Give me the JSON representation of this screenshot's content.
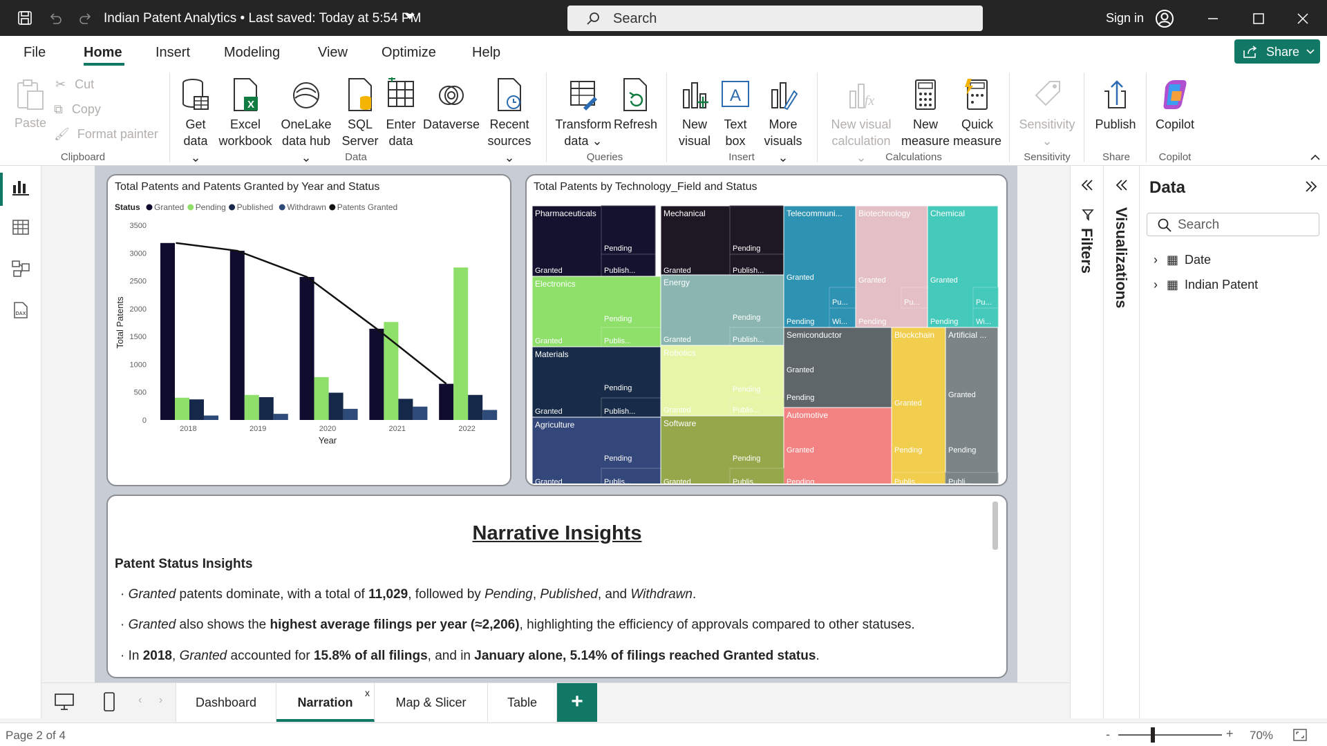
{
  "titlebar": {
    "title": "Indian Patent Analytics • Last saved: Today at 5:54 PM",
    "search_placeholder": "Search",
    "signin": "Sign in"
  },
  "menu": {
    "tabs": [
      "File",
      "Home",
      "Insert",
      "Modeling",
      "View",
      "Optimize",
      "Help"
    ],
    "active": "Home",
    "share": "Share"
  },
  "ribbon": {
    "clipboard": {
      "paste": "Paste",
      "cut": "Cut",
      "copy": "Copy",
      "format_painter": "Format painter",
      "group": "Clipboard"
    },
    "data": {
      "get_data": [
        "Get",
        "data"
      ],
      "excel": [
        "Excel",
        "workbook"
      ],
      "onelake": [
        "OneLake",
        "data hub"
      ],
      "sql": [
        "SQL",
        "Server"
      ],
      "enter": [
        "Enter",
        "data"
      ],
      "dataverse": "Dataverse",
      "recent": [
        "Recent",
        "sources"
      ],
      "group": "Data"
    },
    "queries": {
      "transform": [
        "Transform",
        "data"
      ],
      "refresh": "Refresh",
      "group": "Queries"
    },
    "insert": {
      "new_visual": [
        "New",
        "visual"
      ],
      "text_box": [
        "Text",
        "box"
      ],
      "more_visuals": [
        "More",
        "visuals"
      ],
      "group": "Insert"
    },
    "calculations": {
      "new_visual_calc": [
        "New visual",
        "calculation"
      ],
      "new_measure": [
        "New",
        "measure"
      ],
      "quick_measure": [
        "Quick",
        "measure"
      ],
      "group": "Calculations"
    },
    "sensitivity": {
      "label": "Sensitivity",
      "group": "Sensitivity"
    },
    "share": {
      "publish": "Publish",
      "group": "Share"
    },
    "copilot": {
      "label": "Copilot",
      "group": "Copilot"
    }
  },
  "colors": {
    "accent": "#117865",
    "granted": "#0f0c2e",
    "pending": "#8fe06a",
    "published": "#15284a",
    "withdrawn": "#2d4a78",
    "patents_granted_line": "#111111"
  },
  "bar_chart": {
    "title": "Total Patents and Patents Granted by Year and Status",
    "legend_title": "Status",
    "chart_data": {
      "type": "bar",
      "categories": [
        "2018",
        "2019",
        "2020",
        "2021",
        "2022"
      ],
      "series": [
        {
          "name": "Granted",
          "values": [
            3180,
            3040,
            2570,
            1640,
            650
          ]
        },
        {
          "name": "Pending",
          "values": [
            400,
            450,
            770,
            1760,
            2740
          ]
        },
        {
          "name": "Published",
          "values": [
            370,
            410,
            490,
            380,
            450
          ]
        },
        {
          "name": "Withdrawn",
          "values": [
            80,
            110,
            200,
            240,
            180
          ]
        }
      ],
      "line": {
        "name": "Patents Granted",
        "values": [
          3180,
          3040,
          2570,
          1640,
          650
        ]
      },
      "xlabel": "Year",
      "ylabel": "Total Patents",
      "ylim": [
        0,
        3500
      ],
      "yticks": [
        "0",
        "500",
        "1000",
        "1500",
        "2000",
        "2500",
        "3000",
        "3500"
      ]
    }
  },
  "treemap": {
    "title": "Total Patents by Technology_Field and Status",
    "cells": [
      {
        "label": "Pharmaceuticals",
        "color": "#14122e"
      },
      {
        "label": "Granted",
        "color": "#14122e"
      },
      {
        "label": "Pending",
        "color": "#14122e"
      },
      {
        "label": "Publish...",
        "color": "#14122e"
      },
      {
        "label": "Mechanical",
        "color": "#1d1824"
      },
      {
        "label": "Granted",
        "color": "#1d1824"
      },
      {
        "label": "Pending",
        "color": "#1d1824"
      },
      {
        "label": "Publish...",
        "color": "#1d1824"
      },
      {
        "label": "Telecommuni...",
        "color": "#2e93b2"
      },
      {
        "label": "Granted",
        "color": "#2e93b2"
      },
      {
        "label": "Pending",
        "color": "#2e93b2"
      },
      {
        "label": "Pu...",
        "color": "#2e93b2"
      },
      {
        "label": "Wi...",
        "color": "#2e93b2"
      },
      {
        "label": "Biotechnology",
        "color": "#e4bfc5"
      },
      {
        "label": "Granted",
        "color": "#e4bfc5"
      },
      {
        "label": "Pending",
        "color": "#e4bfc5"
      },
      {
        "label": "Pu...",
        "color": "#e4bfc5"
      },
      {
        "label": "Chemical",
        "color": "#45c9bb"
      },
      {
        "label": "Granted",
        "color": "#45c9bb"
      },
      {
        "label": "Pending",
        "color": "#45c9bb"
      },
      {
        "label": "Pu...",
        "color": "#45c9bb"
      },
      {
        "label": "Wi...",
        "color": "#45c9bb"
      },
      {
        "label": "Electronics",
        "color": "#8fe06a"
      },
      {
        "label": "Granted",
        "color": "#8fe06a"
      },
      {
        "label": "Pending",
        "color": "#8fe06a"
      },
      {
        "label": "Publis...",
        "color": "#8fe06a"
      },
      {
        "label": "Energy",
        "color": "#8ab5b0"
      },
      {
        "label": "Granted",
        "color": "#8ab5b0"
      },
      {
        "label": "Pending",
        "color": "#8ab5b0"
      },
      {
        "label": "Publish...",
        "color": "#8ab5b0"
      },
      {
        "label": "Semiconductor",
        "color": "#5e6669"
      },
      {
        "label": "Granted",
        "color": "#5e6669"
      },
      {
        "label": "Pending",
        "color": "#5e6669"
      },
      {
        "label": "Blockchain",
        "color": "#f2ce4e"
      },
      {
        "label": "Granted",
        "color": "#f2ce4e"
      },
      {
        "label": "Pending",
        "color": "#f2ce4e"
      },
      {
        "label": "Publis...",
        "color": "#f2ce4e"
      },
      {
        "label": "Artificial ...",
        "color": "#7b8587"
      },
      {
        "label": "Granted",
        "color": "#7b8587"
      },
      {
        "label": "Pending",
        "color": "#7b8587"
      },
      {
        "label": "Publi...",
        "color": "#7b8587"
      },
      {
        "label": "Materials",
        "color": "#182b48"
      },
      {
        "label": "Granted",
        "color": "#182b48"
      },
      {
        "label": "Pending",
        "color": "#182b48"
      },
      {
        "label": "Publish...",
        "color": "#182b48"
      },
      {
        "label": "Robotics",
        "color": "#e6f5a8"
      },
      {
        "label": "Granted",
        "color": "#e6f5a8"
      },
      {
        "label": "Pending",
        "color": "#e6f5a8"
      },
      {
        "label": "Publis...",
        "color": "#e6f5a8"
      },
      {
        "label": "Automotive",
        "color": "#f38382"
      },
      {
        "label": "Granted",
        "color": "#f38382"
      },
      {
        "label": "Pending",
        "color": "#f38382"
      },
      {
        "label": "Agriculture",
        "color": "#34477a"
      },
      {
        "label": "Granted",
        "color": "#34477a"
      },
      {
        "label": "Pending",
        "color": "#34477a"
      },
      {
        "label": "Publis...",
        "color": "#34477a"
      },
      {
        "label": "Software",
        "color": "#94a74a"
      },
      {
        "label": "Granted",
        "color": "#94a74a"
      },
      {
        "label": "Pending",
        "color": "#94a74a"
      },
      {
        "label": "Publis...",
        "color": "#94a74a"
      }
    ]
  },
  "narrative": {
    "title": "Narrative Insights",
    "subtitle": "Patent Status Insights",
    "lines": [
      [
        [
          "· ",
          ""
        ],
        [
          "Granted",
          "i"
        ],
        [
          " patents dominate, with a total of ",
          ""
        ],
        [
          "11,029",
          "b"
        ],
        [
          ", followed by ",
          ""
        ],
        [
          "Pending",
          "i"
        ],
        [
          ", ",
          ""
        ],
        [
          "Published",
          "i"
        ],
        [
          ", and ",
          ""
        ],
        [
          "Withdrawn",
          "i"
        ],
        [
          ".",
          ""
        ]
      ],
      [
        [
          "· ",
          ""
        ],
        [
          "Granted",
          "i"
        ],
        [
          " also shows the ",
          ""
        ],
        [
          "highest average filings per year (≈2,206)",
          "b"
        ],
        [
          ", highlighting the efficiency of approvals compared to other statuses.",
          ""
        ]
      ],
      [
        [
          "· In ",
          ""
        ],
        [
          "2018",
          "b"
        ],
        [
          ", ",
          ""
        ],
        [
          "Granted",
          "i"
        ],
        [
          " accounted for ",
          ""
        ],
        [
          "15.8% of all filings",
          "b"
        ],
        [
          ", and in ",
          ""
        ],
        [
          "January alone, 5.14% of filings reached Granted status",
          "b"
        ],
        [
          ".",
          ""
        ]
      ]
    ]
  },
  "panes": {
    "filters": "Filters",
    "visualizations": "Visualizations",
    "data_title": "Data",
    "data_search": "Search",
    "tables": [
      "Date",
      "Indian Patent"
    ]
  },
  "page_tabs": {
    "tabs": [
      "Dashboard",
      "Narration",
      "Map & Slicer",
      "Table"
    ],
    "active": "Narration",
    "close": "x",
    "add": "+"
  },
  "status": {
    "page": "Page 2 of 4",
    "zoom_minus": "-",
    "zoom_plus": "+",
    "zoom": "70%",
    "zoom_level": 0.7
  }
}
